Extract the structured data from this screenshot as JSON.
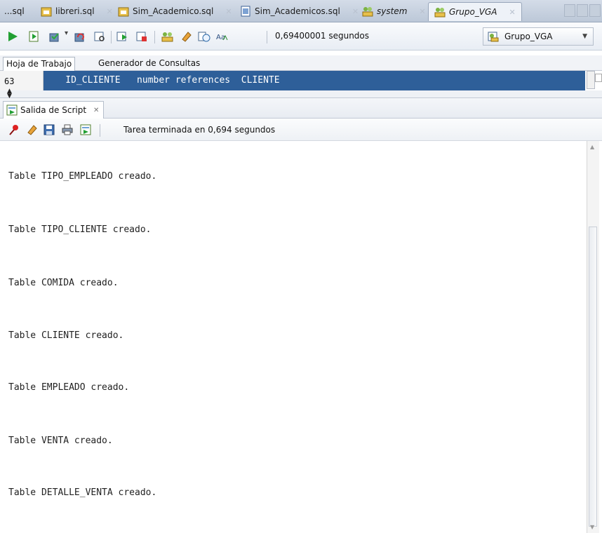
{
  "tabs": [
    {
      "label": "...sql",
      "icon": "none"
    },
    {
      "label": "libreri.sql",
      "icon": "sql-file-icon"
    },
    {
      "label": "Sim_Academico.sql",
      "icon": "sql-file-icon"
    },
    {
      "label": "Sim_Academicos.sql",
      "icon": "sql-file-icon"
    },
    {
      "label": "system",
      "icon": "db-connection-icon"
    },
    {
      "label": "Grupo_VGA",
      "icon": "db-connection-icon"
    }
  ],
  "toolbar": {
    "timing": "0,69400001 segundos",
    "connection": "Grupo_VGA"
  },
  "editor_tabs": [
    "Hoja de Trabajo",
    "Generador de Consultas"
  ],
  "editor": {
    "line_number": "63",
    "code": "    ID_CLIENTE   number references  CLIENTE"
  },
  "output": {
    "tab_label": "Salida de Script",
    "status": "Tarea terminada en 0,694 segundos",
    "lines": [
      "Table TIPO_EMPLEADO creado.",
      "Table TIPO_CLIENTE creado.",
      "Table COMIDA creado.",
      "Table CLIENTE creado.",
      "Table EMPLEADO creado.",
      "Table VENTA creado.",
      "Table DETALLE_VENTA creado."
    ]
  },
  "colors": {
    "accent": "#2e5f99",
    "run_green": "#22a033"
  }
}
